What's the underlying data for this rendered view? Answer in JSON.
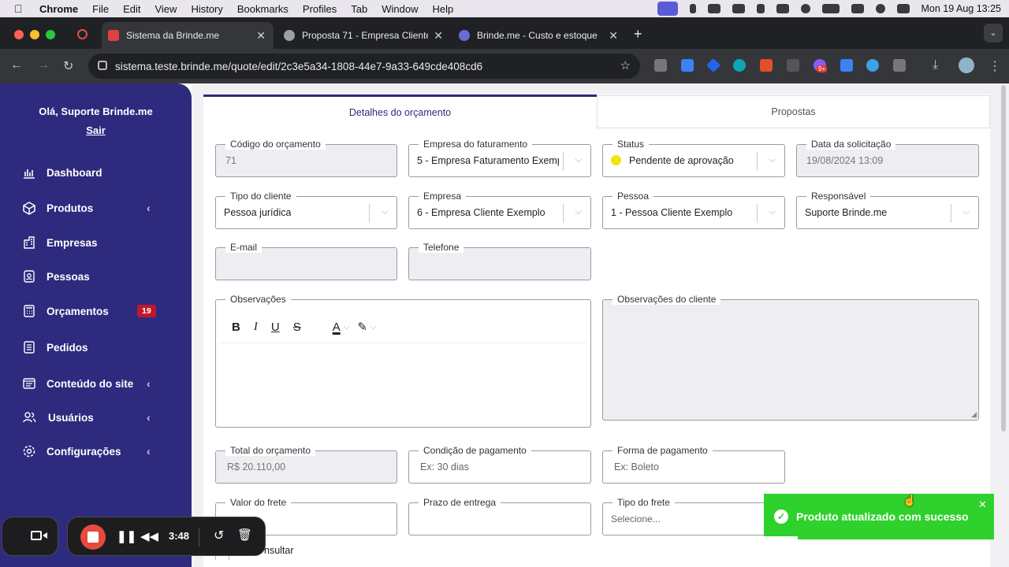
{
  "menubar": {
    "app": "Chrome",
    "items": [
      "File",
      "Edit",
      "View",
      "History",
      "Bookmarks",
      "Profiles",
      "Tab",
      "Window",
      "Help"
    ],
    "datetime": "Mon 19 Aug  13:25"
  },
  "browser": {
    "tabs": [
      {
        "title": "Sistema da Brinde.me",
        "active": true
      },
      {
        "title": "Proposta 71 - Empresa Cliente",
        "active": false
      },
      {
        "title": "Brinde.me - Custo e estoque",
        "active": false
      }
    ],
    "url": "sistema.teste.brinde.me/quote/edit/2c3e5a34-1808-44e7-9a33-649cde408cd6",
    "extension_badge": "9+"
  },
  "sidebar": {
    "greeting": "Olá, Suporte Brinde.me",
    "logout": "Sair",
    "items": [
      {
        "label": "Dashboard",
        "icon": "chart-icon"
      },
      {
        "label": "Produtos",
        "icon": "box-icon",
        "expandable": true
      },
      {
        "label": "Empresas",
        "icon": "building-icon"
      },
      {
        "label": "Pessoas",
        "icon": "person-card-icon"
      },
      {
        "label": "Orçamentos",
        "icon": "calculator-icon",
        "badge": "19"
      },
      {
        "label": "Pedidos",
        "icon": "list-icon"
      },
      {
        "label": "Conteúdo do site",
        "icon": "layout-icon",
        "expandable": true
      },
      {
        "label": "Usuários",
        "icon": "users-icon",
        "expandable": true
      },
      {
        "label": "Configurações",
        "icon": "gear-icon",
        "expandable": true
      }
    ]
  },
  "tabs": {
    "details": "Detalhes do orçamento",
    "proposals": "Propostas"
  },
  "form": {
    "codigo": {
      "label": "Código do orçamento",
      "value": "71"
    },
    "empresa_faturamento": {
      "label": "Empresa do faturamento",
      "value": "5 - Empresa Faturamento Exemp"
    },
    "status": {
      "label": "Status",
      "value": "Pendente de aprovação",
      "dot_color": "#f5e30a"
    },
    "data_solicitacao": {
      "label": "Data da solicitação",
      "value": "19/08/2024 13:09"
    },
    "tipo_cliente": {
      "label": "Tipo do cliente",
      "value": "Pessoa jurídica"
    },
    "empresa": {
      "label": "Empresa",
      "value": "6 - Empresa Cliente Exemplo"
    },
    "pessoa": {
      "label": "Pessoa",
      "value": "1 - Pessoa Cliente Exemplo"
    },
    "responsavel": {
      "label": "Responsável",
      "value": "Suporte Brinde.me"
    },
    "email": {
      "label": "E-mail",
      "value": ""
    },
    "telefone": {
      "label": "Telefone",
      "value": ""
    },
    "observacoes": {
      "label": "Observações"
    },
    "observacoes_cliente": {
      "label": "Observações do cliente"
    },
    "total": {
      "label": "Total do orçamento",
      "value": "R$ 20.110,00"
    },
    "condicao_pagamento": {
      "label": "Condição de pagamento",
      "placeholder": "Ex: 30 dias"
    },
    "forma_pagamento": {
      "label": "Forma de pagamento",
      "placeholder": "Ex: Boleto"
    },
    "valor_frete": {
      "label": "Valor do frete",
      "value": ""
    },
    "prazo_entrega": {
      "label": "Prazo de entrega",
      "value": ""
    },
    "tipo_frete": {
      "label": "Tipo do frete",
      "placeholder": "Selecione..."
    },
    "partial_checkbox_label": "nsultar"
  },
  "toast": {
    "message": "Produto atualizado com sucesso",
    "color": "#2fd12c"
  },
  "recorder": {
    "time": "3:48"
  },
  "colors": {
    "sidebar": "#2e2a7e",
    "accent": "#2e2a7e",
    "badge": "#c0182a"
  }
}
